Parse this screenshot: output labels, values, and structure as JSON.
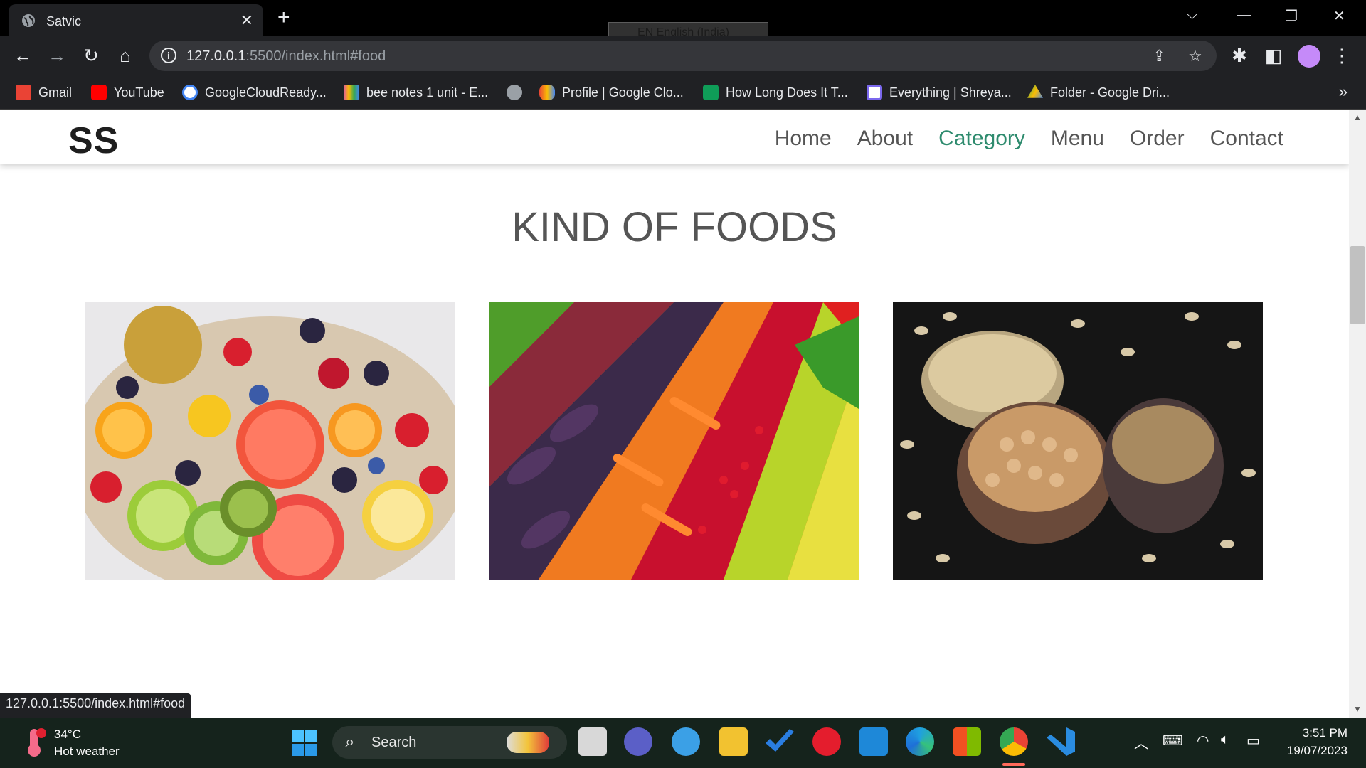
{
  "browser": {
    "tab_title": "Satvic",
    "lang_popup": "EN English (India)",
    "url_host": "127.0.0.1",
    "url_path": ":5500/index.html#food",
    "bookmarks": [
      {
        "label": "Gmail",
        "color": "#ea4335"
      },
      {
        "label": "YouTube",
        "color": "#ff0000"
      },
      {
        "label": "GoogleCloudReady...",
        "color": "#4285f4"
      },
      {
        "label": "bee notes 1 unit - E...",
        "color": "#e056a0"
      },
      {
        "label": "",
        "color": "#9aa0a6"
      },
      {
        "label": "Profile | Google Clo...",
        "color": "#fbbc04"
      },
      {
        "label": "How Long Does It T...",
        "color": "#0f9d58"
      },
      {
        "label": "Everything | Shreya...",
        "color": "#7b68ee"
      },
      {
        "label": "Folder - Google Dri...",
        "color": "#34a853"
      }
    ],
    "status_url": "127.0.0.1:5500/index.html#food"
  },
  "site": {
    "logo": "SS",
    "nav": [
      "Home",
      "About",
      "Category",
      "Menu",
      "Order",
      "Contact"
    ],
    "active_nav": "Category",
    "accent_color": "#2e8b6e",
    "section_title": "KIND OF FOODS",
    "foods": [
      {
        "name": "fruits-image"
      },
      {
        "name": "vegetables-image"
      },
      {
        "name": "grains-image"
      }
    ]
  },
  "taskbar": {
    "temperature": "34°C",
    "weather": "Hot weather",
    "search_label": "Search",
    "time": "3:51 PM",
    "date": "19/07/2023"
  }
}
